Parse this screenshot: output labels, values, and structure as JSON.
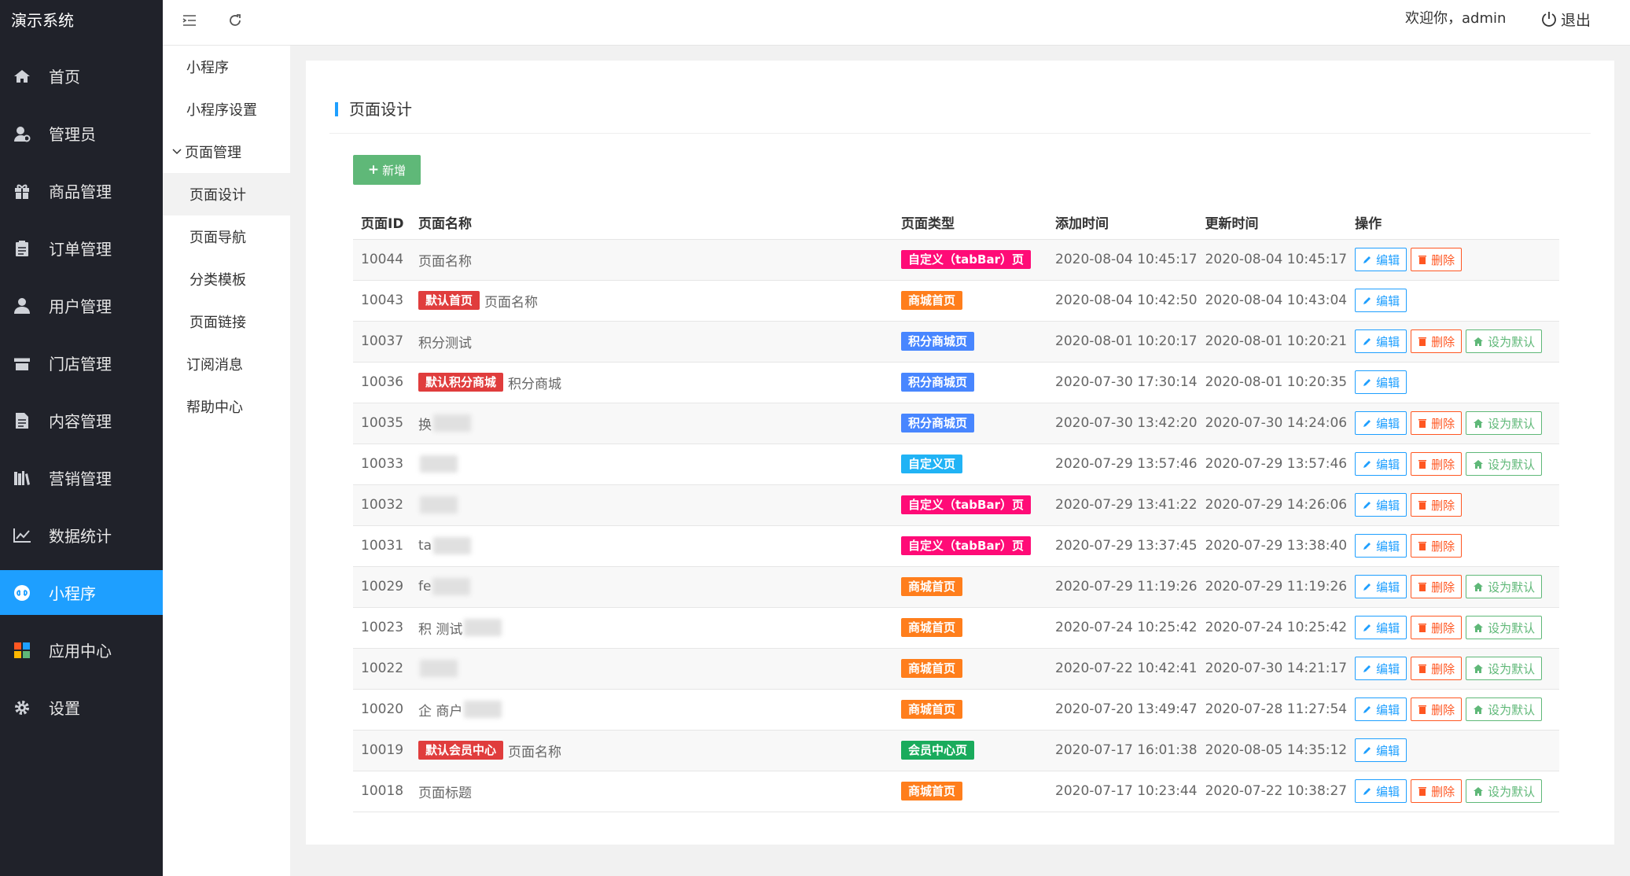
{
  "app": {
    "title": "演示系统"
  },
  "nav": {
    "items": [
      {
        "label": "首页",
        "icon": "home-icon"
      },
      {
        "label": "管理员",
        "icon": "admin-user-icon"
      },
      {
        "label": "商品管理",
        "icon": "gift-icon"
      },
      {
        "label": "订单管理",
        "icon": "clipboard-icon"
      },
      {
        "label": "用户管理",
        "icon": "user-icon"
      },
      {
        "label": "门店管理",
        "icon": "store-icon"
      },
      {
        "label": "内容管理",
        "icon": "document-icon"
      },
      {
        "label": "营销管理",
        "icon": "books-icon"
      },
      {
        "label": "数据统计",
        "icon": "line-chart-icon"
      },
      {
        "label": "小程序",
        "icon": "miniprogram-icon",
        "active": true
      },
      {
        "label": "应用中心",
        "icon": "apps-grid-icon"
      },
      {
        "label": "设置",
        "icon": "gear-icon"
      }
    ]
  },
  "subnav": {
    "items": [
      {
        "label": "小程序"
      },
      {
        "label": "小程序设置"
      },
      {
        "label": "页面管理",
        "group": true
      },
      {
        "label": "页面设计",
        "child": true,
        "selected": true
      },
      {
        "label": "页面导航",
        "child": true
      },
      {
        "label": "分类模板",
        "child": true
      },
      {
        "label": "页面链接",
        "child": true
      },
      {
        "label": "订阅消息"
      },
      {
        "label": "帮助中心"
      }
    ]
  },
  "header": {
    "welcome": "欢迎你，admin",
    "logout": "退出"
  },
  "page": {
    "title": "页面设计",
    "add_button": "新增"
  },
  "table": {
    "headers": [
      "页面ID",
      "页面名称",
      "页面类型",
      "添加时间",
      "更新时间",
      "操作"
    ],
    "action_labels": {
      "edit": "编辑",
      "delete": "删除",
      "set_default": "设为默认"
    },
    "rows": [
      {
        "id": "10044",
        "default_badge": "",
        "name": "页面名称",
        "type": "自定义（tabBar）页",
        "type_color": "#ff0b77",
        "added": "2020-08-04 10:45:17",
        "updated": "2020-08-04 10:45:17",
        "actions": [
          "edit",
          "delete"
        ]
      },
      {
        "id": "10043",
        "default_badge": "默认首页",
        "name": "页面名称",
        "type": "商城首页",
        "type_color": "#ff7e1c",
        "added": "2020-08-04 10:42:50",
        "updated": "2020-08-04 10:43:04",
        "actions": [
          "edit"
        ]
      },
      {
        "id": "10037",
        "default_badge": "",
        "name": "积分测试",
        "type": "积分商城页",
        "type_color": "#4886ff",
        "added": "2020-08-01 10:20:17",
        "updated": "2020-08-01 10:20:21",
        "actions": [
          "edit",
          "delete",
          "set_default"
        ]
      },
      {
        "id": "10036",
        "default_badge": "默认积分商城",
        "name": "积分商城",
        "type": "积分商城页",
        "type_color": "#4886ff",
        "added": "2020-07-30 17:30:14",
        "updated": "2020-08-01 10:20:35",
        "actions": [
          "edit"
        ]
      },
      {
        "id": "10035",
        "default_badge": "",
        "name": "换",
        "blurred": true,
        "type": "积分商城页",
        "type_color": "#4886ff",
        "added": "2020-07-30 13:42:20",
        "updated": "2020-07-30 14:24:06",
        "actions": [
          "edit",
          "delete",
          "set_default"
        ]
      },
      {
        "id": "10033",
        "default_badge": "",
        "name": "",
        "blurred": true,
        "type": "自定义页",
        "type_color": "#21b3f5",
        "added": "2020-07-29 13:57:46",
        "updated": "2020-07-29 13:57:46",
        "actions": [
          "edit",
          "delete",
          "set_default"
        ]
      },
      {
        "id": "10032",
        "default_badge": "",
        "name": "",
        "blurred": true,
        "type": "自定义（tabBar）页",
        "type_color": "#ff0b77",
        "added": "2020-07-29 13:41:22",
        "updated": "2020-07-29 14:26:06",
        "actions": [
          "edit",
          "delete"
        ]
      },
      {
        "id": "10031",
        "default_badge": "",
        "name": "ta",
        "blurred": true,
        "type": "自定义（tabBar）页",
        "type_color": "#ff0b77",
        "added": "2020-07-29 13:37:45",
        "updated": "2020-07-29 13:38:40",
        "actions": [
          "edit",
          "delete"
        ]
      },
      {
        "id": "10029",
        "default_badge": "",
        "name": "fe",
        "blurred": true,
        "type": "商城首页",
        "type_color": "#ff7e1c",
        "added": "2020-07-29 11:19:26",
        "updated": "2020-07-29 11:19:26",
        "actions": [
          "edit",
          "delete",
          "set_default"
        ]
      },
      {
        "id": "10023",
        "default_badge": "",
        "name": "积 测试",
        "blurred": true,
        "type": "商城首页",
        "type_color": "#ff7e1c",
        "added": "2020-07-24 10:25:42",
        "updated": "2020-07-24 10:25:42",
        "actions": [
          "edit",
          "delete",
          "set_default"
        ]
      },
      {
        "id": "10022",
        "default_badge": "",
        "name": "",
        "blurred": true,
        "type": "商城首页",
        "type_color": "#ff7e1c",
        "added": "2020-07-22 10:42:41",
        "updated": "2020-07-30 14:21:17",
        "actions": [
          "edit",
          "delete",
          "set_default"
        ]
      },
      {
        "id": "10020",
        "default_badge": "",
        "name": "企 商户",
        "blurred": true,
        "type": "商城首页",
        "type_color": "#ff7e1c",
        "added": "2020-07-20 13:49:47",
        "updated": "2020-07-28 11:27:54",
        "actions": [
          "edit",
          "delete",
          "set_default"
        ]
      },
      {
        "id": "10019",
        "default_badge": "默认会员中心",
        "name": "页面名称",
        "type": "会员中心页",
        "type_color": "#1aab5c",
        "added": "2020-07-17 16:01:38",
        "updated": "2020-08-05 14:35:12",
        "actions": [
          "edit"
        ]
      },
      {
        "id": "10018",
        "default_badge": "",
        "name": "页面标题",
        "type": "商城首页",
        "type_color": "#ff7e1c",
        "added": "2020-07-17 10:23:44",
        "updated": "2020-07-22 10:38:27",
        "actions": [
          "edit",
          "delete",
          "set_default"
        ]
      }
    ]
  },
  "colors": {
    "sidebar_bg": "#20222a",
    "accent": "#1e9fff",
    "default_badge": "#e03d3d",
    "add_button": "#5fb878"
  }
}
